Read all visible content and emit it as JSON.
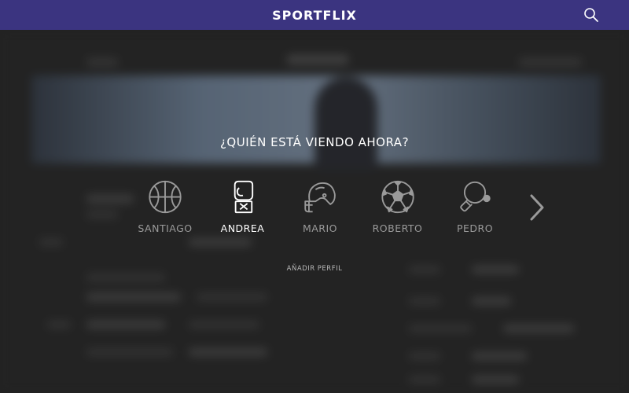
{
  "app": {
    "title": "SPORTFLIX"
  },
  "profile_picker": {
    "question": "¿QUIÉN ESTÁ VIENDO AHORA?",
    "profiles": [
      {
        "name": "SANTIAGO",
        "icon": "basketball-icon",
        "active": false
      },
      {
        "name": "ANDREA",
        "icon": "boxing-glove-icon",
        "active": true
      },
      {
        "name": "MARIO",
        "icon": "football-helmet-icon",
        "active": false
      },
      {
        "name": "ROBERTO",
        "icon": "soccer-ball-icon",
        "active": false
      },
      {
        "name": "PEDRO",
        "icon": "ping-pong-paddle-icon",
        "active": false
      }
    ],
    "add_profile_label": "AÑADIR PERFIL"
  },
  "colors": {
    "header": "#3b3480",
    "active": "#ffffff",
    "inactive": "#9a9a9a"
  }
}
